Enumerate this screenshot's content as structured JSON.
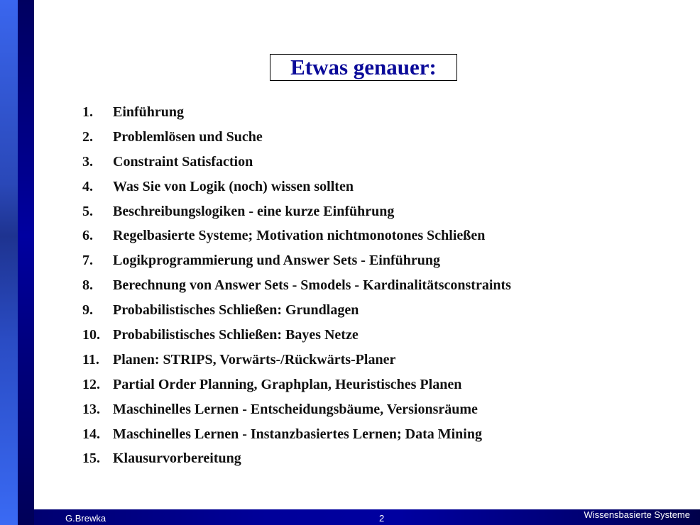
{
  "slide": {
    "title": "Etwas genauer:",
    "items": [
      {
        "number": "1.",
        "text": "Einführung"
      },
      {
        "number": "2.",
        "text": "Problemlösen und Suche"
      },
      {
        "number": "3.",
        "text": "Constraint Satisfaction"
      },
      {
        "number": "4.",
        "text": "Was Sie von Logik (noch) wissen sollten"
      },
      {
        "number": "5.",
        "text": "Beschreibungslogiken - eine kurze Einführung"
      },
      {
        "number": "6.",
        "text": "Regelbasierte Systeme; Motivation nichtmonotones Schließen"
      },
      {
        "number": "7.",
        "text": "Logikprogrammierung und Answer Sets - Einführung"
      },
      {
        "number": "8.",
        "text": "Berechnung von Answer Sets - Smodels - Kardinalitätsconstraints"
      },
      {
        "number": "9.",
        "text": "Probabilistisches Schließen: Grundlagen"
      },
      {
        "number": "10.",
        "text": "Probabilistisches Schließen: Bayes Netze"
      },
      {
        "number": "11.",
        "text": "Planen: STRIPS, Vorwärts-/Rückwärts-Planer"
      },
      {
        "number": "12.",
        "text": "Partial Order Planning, Graphplan, Heuristisches Planen"
      },
      {
        "number": "13.",
        "text": "Maschinelles Lernen - Entscheidungsbäume, Versionsräume"
      },
      {
        "number": "14.",
        "text": "Maschinelles Lernen - Instanzbasiertes Lernen; Data Mining"
      },
      {
        "number": "15.",
        "text": "Klausurvorbereitung"
      }
    ]
  },
  "footer": {
    "author": "G.Brewka",
    "page_number": "2",
    "course": "Wissensbasierte Systeme"
  },
  "colors": {
    "title": "#0a0a99",
    "accent_light": "#3a66ee",
    "accent_dark": "#000080",
    "text": "#111111"
  }
}
